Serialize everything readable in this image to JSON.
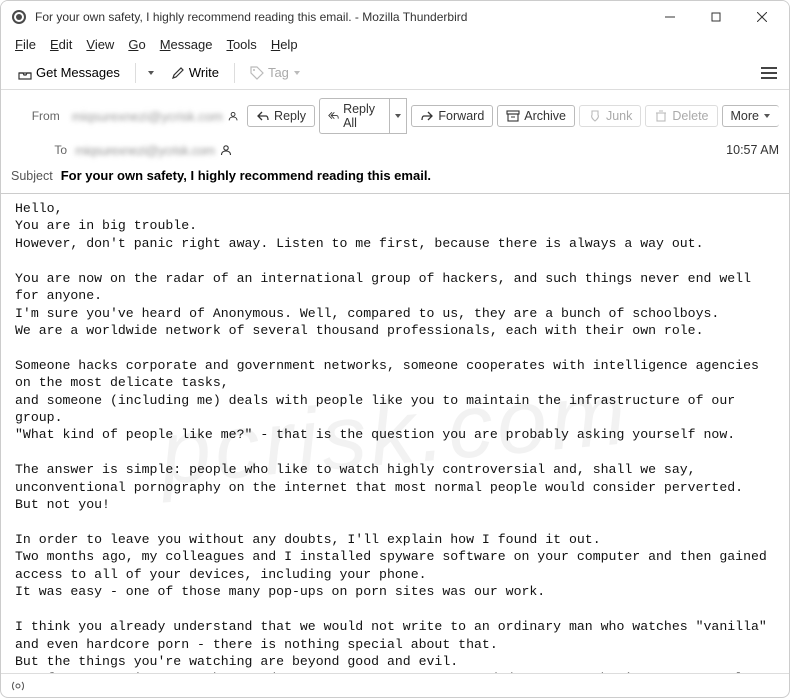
{
  "window": {
    "title": "For your own safety, I highly recommend reading this email. - Mozilla Thunderbird"
  },
  "menu": {
    "file": "File",
    "edit": "Edit",
    "view": "View",
    "go": "Go",
    "message": "Message",
    "tools": "Tools",
    "help": "Help"
  },
  "toolbar": {
    "get_messages": "Get Messages",
    "write": "Write",
    "tag": "Tag"
  },
  "actions": {
    "reply": "Reply",
    "reply_all": "Reply All",
    "forward": "Forward",
    "archive": "Archive",
    "junk": "Junk",
    "delete": "Delete",
    "more": "More"
  },
  "headers": {
    "from_label": "From",
    "to_label": "To",
    "subject_label": "Subject",
    "from_value": "miqsurexnezi@ycrisk.com",
    "to_value": "miqsurexnezi@ycrisk.com",
    "time": "10:57 AM",
    "subject": "For your own safety, I highly recommend reading this email."
  },
  "body": "Hello,\nYou are in big trouble.\nHowever, don't panic right away. Listen to me first, because there is always a way out.\n\nYou are now on the radar of an international group of hackers, and such things never end well for anyone.\nI'm sure you've heard of Anonymous. Well, compared to us, they are a bunch of schoolboys.\nWe are a worldwide network of several thousand professionals, each with their own role.\n\nSomeone hacks corporate and government networks, someone cooperates with intelligence agencies on the most delicate tasks,\nand someone (including me) deals with people like you to maintain the infrastructure of our group.\n\"What kind of people like me?\" - that is the question you are probably asking yourself now.\n\nThe answer is simple: people who like to watch highly controversial and, shall we say, unconventional pornography on the internet that most normal people would consider perverted.\nBut not you!\n\nIn order to leave you without any doubts, I'll explain how I found it out.\nTwo months ago, my colleagues and I installed spyware software on your computer and then gained access to all of your devices, including your phone.\nIt was easy - one of those many pop-ups on porn sites was our work.\n\nI think you already understand that we would not write to an ordinary man who watches \"vanilla\" and even hardcore porn - there is nothing special about that.\nBut the things you're watching are beyond good and evil.\nSo after accessing your phone and computer cameras, we recorded you masturbating to extremely controversial videos."
}
